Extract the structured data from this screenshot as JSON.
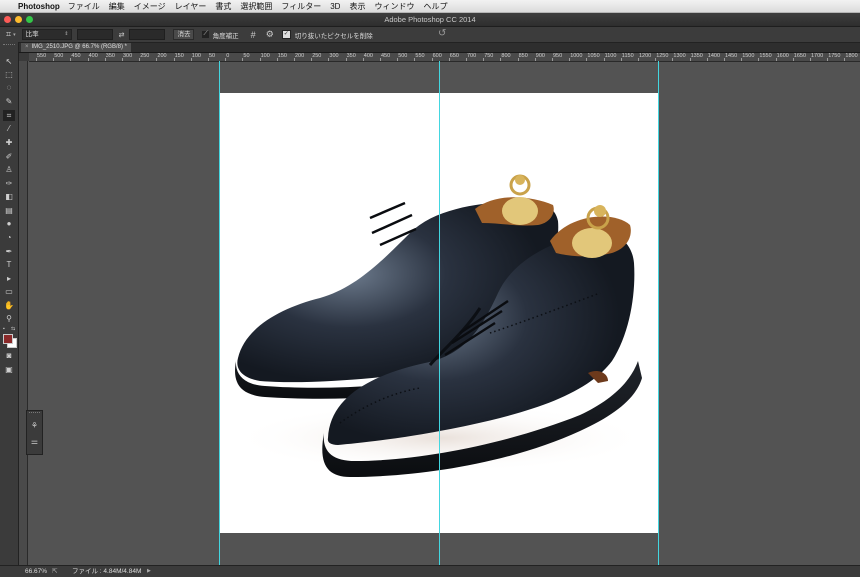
{
  "menubar": {
    "app_name": "Photoshop",
    "items": [
      "ファイル",
      "編集",
      "イメージ",
      "レイヤー",
      "書式",
      "選択範囲",
      "フィルター",
      "3D",
      "表示",
      "ウィンドウ",
      "ヘルプ"
    ]
  },
  "window": {
    "title": "Adobe Photoshop CC 2014"
  },
  "options_bar": {
    "ratio_select": "比率",
    "clear_button": "消去",
    "straighten_label": "角度補正",
    "delete_cropped_label": "切り抜いたピクセルを削除",
    "delete_cropped_checked": true
  },
  "document_tab": {
    "label": "IMG_2510.JPG @ 66.7% (RGB/8) *"
  },
  "ruler": {
    "labels": [
      "550",
      "500",
      "450",
      "400",
      "350",
      "300",
      "250",
      "200",
      "150",
      "100",
      "50",
      "0",
      "50",
      "100",
      "150",
      "200",
      "250",
      "300",
      "350",
      "400",
      "450",
      "500",
      "550",
      "600",
      "650",
      "700",
      "750",
      "800",
      "850",
      "900",
      "950",
      "1000",
      "1050",
      "1100",
      "1150",
      "1200",
      "1250",
      "1300",
      "1350",
      "1400",
      "1450",
      "1500",
      "1550",
      "1600",
      "1650",
      "1700",
      "1750",
      "1800"
    ]
  },
  "colors": {
    "foreground": "#8b2a2a",
    "background": "#ffffff",
    "guide": "#43d6e0"
  },
  "status": {
    "zoom": "66.67%",
    "file_info": "ファイル : 4.84M/4.84M"
  }
}
